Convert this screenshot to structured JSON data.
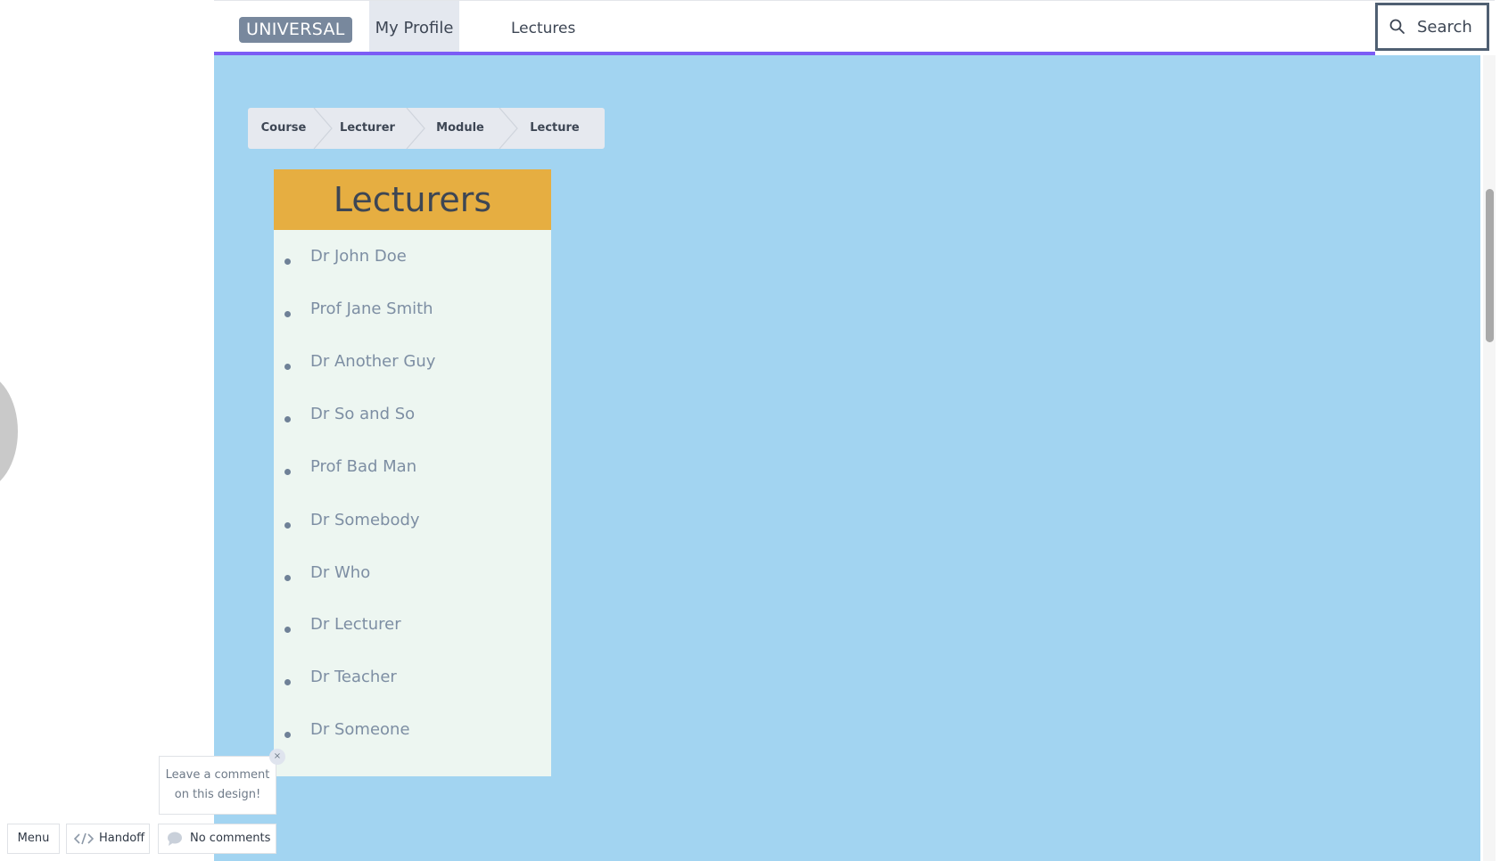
{
  "header": {
    "brand": "UNIVERSAL",
    "nav": [
      {
        "label": "My Profile"
      },
      {
        "label": "Lectures"
      }
    ],
    "search_label": "Search"
  },
  "breadcrumb": [
    "Course",
    "Lecturer",
    "Module",
    "Lecture"
  ],
  "lecturers": {
    "title": "Lecturers",
    "items": [
      "Dr John Doe",
      "Prof Jane Smith",
      "Dr Another Guy",
      "Dr So and So",
      "Prof Bad Man",
      "Dr Somebody",
      "Dr Who",
      "Dr Lecturer",
      "Dr Teacher",
      "Dr Someone"
    ]
  },
  "comment_prompt": {
    "line1": "Leave a comment",
    "line2": "on this design!",
    "close": "×"
  },
  "toolbar": {
    "menu": "Menu",
    "handoff": "Handoff",
    "comments": "No comments"
  },
  "colors": {
    "canvas": "#a2d4f1",
    "accent": "#7b5cf5",
    "panel_header": "#e6ae41",
    "brand_badge": "#78889d"
  }
}
